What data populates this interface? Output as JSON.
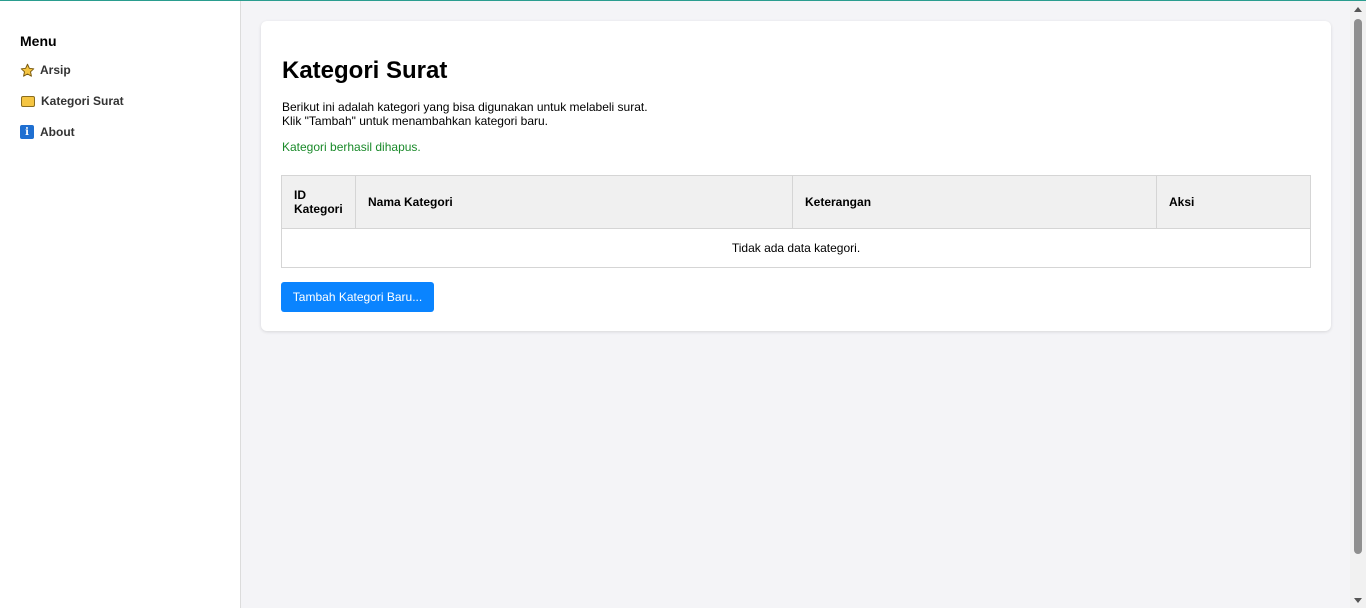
{
  "sidebar": {
    "title": "Menu",
    "items": [
      {
        "label": "Arsip",
        "icon": "star-icon"
      },
      {
        "label": "Kategori Surat",
        "icon": "folder-icon"
      },
      {
        "label": "About",
        "icon": "info-icon"
      }
    ]
  },
  "main": {
    "title": "Kategori Surat",
    "description_line1": "Berikut ini adalah kategori yang bisa digunakan untuk melabeli surat.",
    "description_line2": "Klik \"Tambah\" untuk menambahkan kategori baru.",
    "status_message": "Kategori berhasil dihapus.",
    "table": {
      "headers": [
        "ID\nKategori",
        "Nama Kategori",
        "Keterangan",
        "Aksi"
      ],
      "header_id_line1": "ID",
      "header_id_line2": "Kategori",
      "empty_message": "Tidak ada data kategori."
    },
    "add_button_label": "Tambah Kategori Baru..."
  },
  "colors": {
    "accent": "#0a84ff",
    "success": "#1a8a2a",
    "top_border": "#2a9d8f"
  }
}
